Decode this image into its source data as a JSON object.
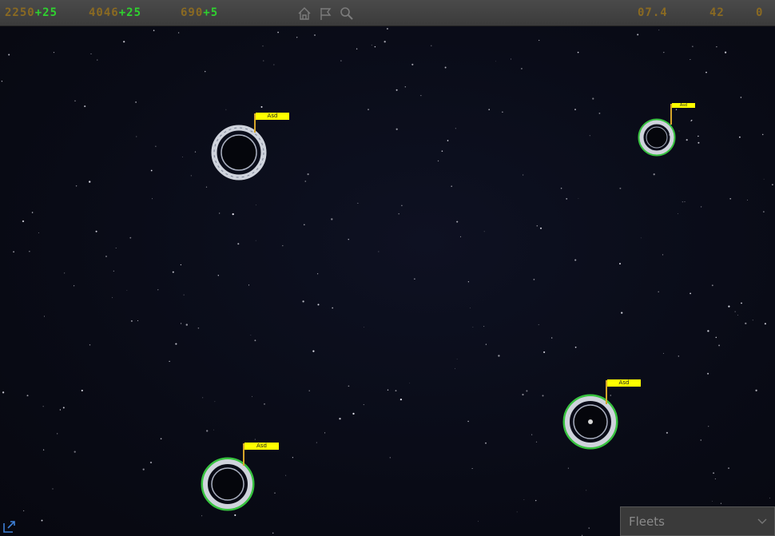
{
  "topbar": {
    "resources": [
      {
        "value": "2250",
        "income": "+25"
      },
      {
        "value": "4046",
        "income": "+25"
      },
      {
        "value": "690",
        "income": "+5"
      }
    ],
    "icons": [
      "home-icon",
      "flag-icon",
      "search-icon"
    ],
    "stats": [
      "07.4",
      "42",
      "0"
    ]
  },
  "planets": [
    {
      "flag_label": "Asd",
      "ring": "white"
    },
    {
      "flag_label": "Asd",
      "ring": "green"
    },
    {
      "flag_label": "Asd",
      "ring": "green"
    },
    {
      "flag_label": "Asd",
      "ring": "green"
    }
  ],
  "fleets_panel": {
    "label": "Fleets"
  },
  "colors": {
    "ring_green": "#37c23f",
    "flag_yellow": "#ffff00",
    "pole_gold": "#d6a52a"
  }
}
